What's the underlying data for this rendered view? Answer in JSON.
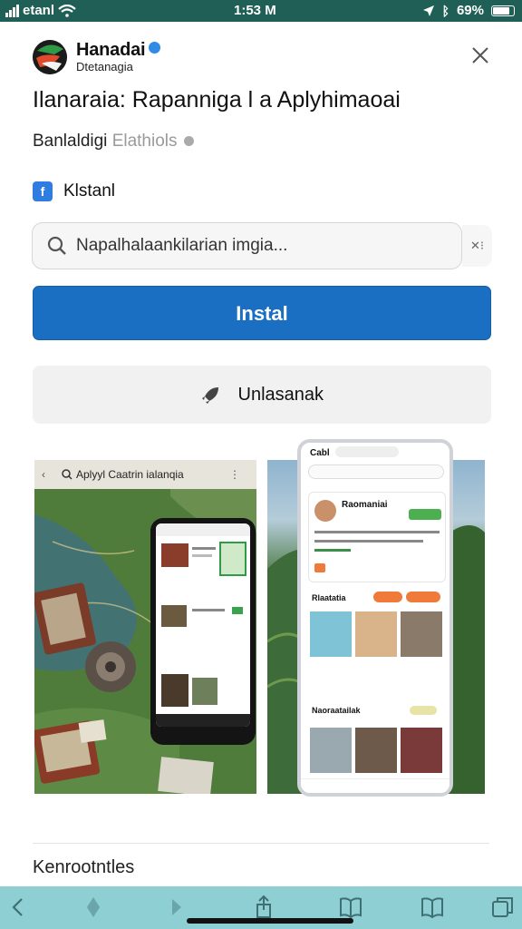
{
  "status_bar": {
    "carrier": "etanl",
    "time": "1:53 M",
    "battery": "69%"
  },
  "header": {
    "app_name": "Hanadai",
    "developer": "Dtetanagia",
    "close_icon": "close-icon"
  },
  "title": "Ilanaraia: Rapanniga l a Aplyhimaoai",
  "subtitle": {
    "main": "Banlaldigi",
    "muted": "Elathiols"
  },
  "category": {
    "label": "Klstanl",
    "icon": "app-category-icon"
  },
  "search": {
    "placeholder": "Napalhalaankilarian imgia..."
  },
  "actions": {
    "install_label": "Instal",
    "uninstall_label": "Unlasanak"
  },
  "screenshot1": {
    "search_text": "Aplyyl Caatrin ialanqia"
  },
  "screenshot2": {
    "top_label": "Cabl",
    "profile_name": "Raomaniai",
    "section1": "Rlaatatia",
    "section2": "Naoraatailak"
  },
  "more_section": {
    "label": "Kenrootntles"
  },
  "colors": {
    "accent": "#1a6fc3",
    "status_bar": "#1f5f55",
    "toolbar": "#8dcfd2"
  }
}
